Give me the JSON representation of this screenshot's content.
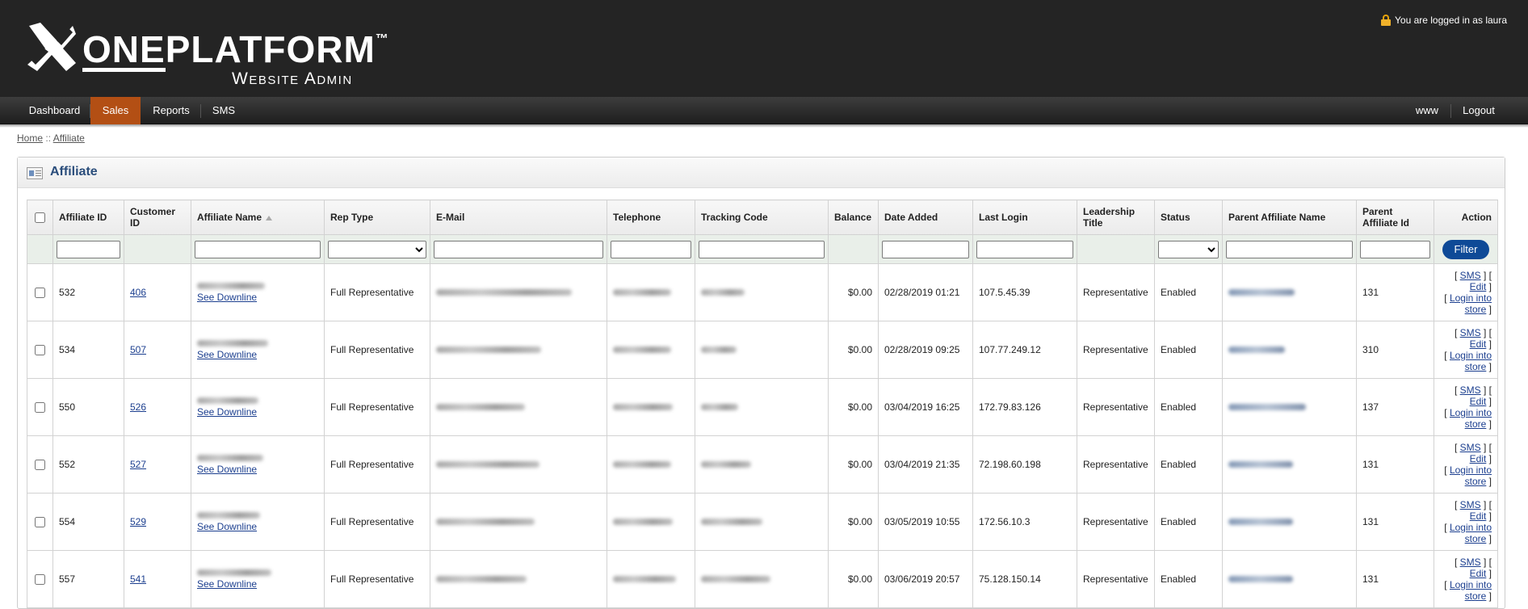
{
  "header": {
    "brand_one": "ONE",
    "brand_platform": "PLATFORM",
    "brand_tm": "™",
    "brand_sub": "Website Admin",
    "login_status": "You are logged in as laura"
  },
  "nav": {
    "items": [
      "Dashboard",
      "Sales",
      "Reports",
      "SMS"
    ],
    "active": "Sales",
    "right_items": [
      "www",
      "Logout"
    ]
  },
  "breadcrumb": {
    "home": "Home",
    "sep": "::",
    "current": "Affiliate"
  },
  "panel": {
    "title": "Affiliate"
  },
  "table": {
    "columns": [
      "Affiliate ID",
      "Customer ID",
      "Affiliate Name",
      "Rep Type",
      "E-Mail",
      "Telephone",
      "Tracking Code",
      "Balance",
      "Date Added",
      "Last Login",
      "Leadership Title",
      "Status",
      "Parent Affiliate Name",
      "Parent Affiliate Id",
      "Action"
    ],
    "sorted_column": "Affiliate Name",
    "filter_button": "Filter",
    "see_downline": "See Downline",
    "actions": {
      "sms": "SMS",
      "edit": "Edit",
      "login": "Login into store"
    },
    "rows": [
      {
        "affiliate_id": "532",
        "customer_id": "406",
        "rep_type": "Full Representative",
        "balance": "$0.00",
        "date_added": "02/28/2019 01:21",
        "last_login": "107.5.45.39",
        "leadership_title": "Representative",
        "status": "Enabled",
        "parent_id": "131"
      },
      {
        "affiliate_id": "534",
        "customer_id": "507",
        "rep_type": "Full Representative",
        "balance": "$0.00",
        "date_added": "02/28/2019 09:25",
        "last_login": "107.77.249.12",
        "leadership_title": "Representative",
        "status": "Enabled",
        "parent_id": "310"
      },
      {
        "affiliate_id": "550",
        "customer_id": "526",
        "rep_type": "Full Representative",
        "balance": "$0.00",
        "date_added": "03/04/2019 16:25",
        "last_login": "172.79.83.126",
        "leadership_title": "Representative",
        "status": "Enabled",
        "parent_id": "137"
      },
      {
        "affiliate_id": "552",
        "customer_id": "527",
        "rep_type": "Full Representative",
        "balance": "$0.00",
        "date_added": "03/04/2019 21:35",
        "last_login": "72.198.60.198",
        "leadership_title": "Representative",
        "status": "Enabled",
        "parent_id": "131"
      },
      {
        "affiliate_id": "554",
        "customer_id": "529",
        "rep_type": "Full Representative",
        "balance": "$0.00",
        "date_added": "03/05/2019 10:55",
        "last_login": "172.56.10.3",
        "leadership_title": "Representative",
        "status": "Enabled",
        "parent_id": "131"
      },
      {
        "affiliate_id": "557",
        "customer_id": "541",
        "rep_type": "Full Representative",
        "balance": "$0.00",
        "date_added": "03/06/2019 20:57",
        "last_login": "75.128.150.14",
        "leadership_title": "Representative",
        "status": "Enabled",
        "parent_id": "131"
      }
    ]
  },
  "colors": {
    "header_bg": "#242424",
    "nav_active": "#b34f14",
    "link": "#1c3f8f",
    "title": "#2a4d7b",
    "filter_button": "#0e4a97"
  }
}
